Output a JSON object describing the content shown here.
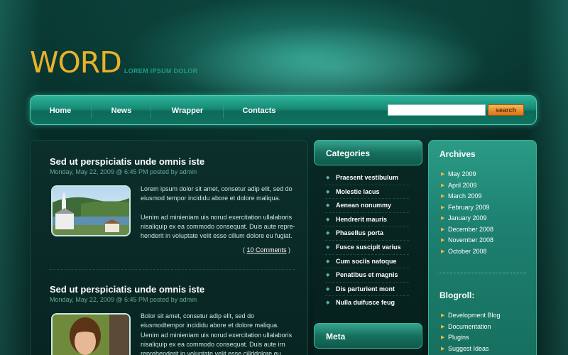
{
  "logo": {
    "word": "WORD",
    "tagline": "LOREM IPSUM DOLOR"
  },
  "nav": {
    "items": [
      "Home",
      "News",
      "Wrapper",
      "Contacts"
    ],
    "search_placeholder": "",
    "search_button": "search"
  },
  "posts": [
    {
      "title": "Sed ut perspiciatis unde omnis iste",
      "meta": "Monday, May 22, 2009 @ 6:45 PM posted by admin",
      "paragraphs": [
        "Lorem ipsum dolor sit amet, consetur adip elit, sed do eiusmod tempor incididu abore et dolore maliqua.",
        "Uenim ad minieniam uis norud exercitation ullalaboris nisaliquip ex ea commodo consequat. Duis aute repre-henderit in voluptate velit esse cillum dolore eu fugiat."
      ],
      "comments_open": "(",
      "comments_link": "10 Comments",
      "comments_close": ")",
      "thumb_icon": "church-landscape-image"
    },
    {
      "title": "Sed ut perspiciatis unde omnis iste",
      "meta": "Monday, May 22, 2009 @ 6:45 PM posted by admin",
      "paragraphs": [
        "Bolor sit amet, consetur adip elit, sed do eiusmodtempor incididu abore et dolore maliqua. Uenim ad minieniam uis norud exercitation ullalaboris nisaliquip ex ea commodo consequat. Duis aute irn reprehenderit in voluptate velit esse cillddolore eu fugiat nulla pariatur. Excepit occaecat"
      ],
      "thumb_icon": "boy-portrait-image"
    }
  ],
  "categories": {
    "title": "Categories",
    "items": [
      "Praesent vestibulum",
      "Molestie lacus",
      "Aenean nonummy",
      "Hendrerit mauris",
      "Phasellus porta",
      "Fusce suscipit varius",
      "Cum sociis natoque",
      "Penatibus et magnis",
      "Dis parturient mont",
      "Nulla duifusce feug"
    ],
    "meta_title": "Meta"
  },
  "archives": {
    "title": "Archives",
    "items": [
      "May 2009",
      "April 2009",
      "March 2009",
      "February 2009",
      "January 2009",
      "December 2008",
      "November 2008",
      "October 2008"
    ]
  },
  "blogroll": {
    "title": "Blogroll:",
    "items": [
      "Development Blog",
      "Documentation",
      "Plugins",
      "Suggest Ideas"
    ]
  },
  "colors": {
    "logo": "#e9b129",
    "accent": "#1f9a86",
    "search_button": "#d9741a"
  }
}
